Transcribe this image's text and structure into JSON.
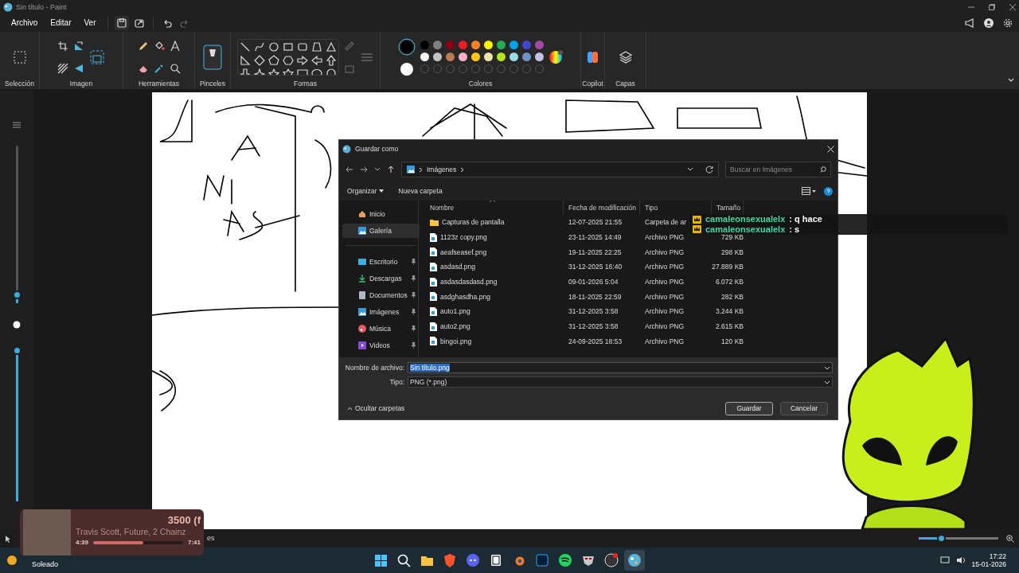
{
  "window": {
    "title": "Sin título - Paint"
  },
  "menu": [
    {
      "label": "Archivo"
    },
    {
      "label": "Editar"
    },
    {
      "label": "Ver"
    }
  ],
  "quick_actions": [
    {
      "kind": "save",
      "disabled": false
    },
    {
      "kind": "share",
      "disabled": false
    },
    {
      "kind": "undo",
      "disabled": false
    },
    {
      "kind": "redo",
      "disabled": true
    }
  ],
  "ribbon": {
    "groups": [
      {
        "kind": "selection",
        "label": "Selección"
      },
      {
        "kind": "image",
        "label": "Imagen"
      },
      {
        "kind": "tools",
        "label": "Herramientas"
      },
      {
        "kind": "brushes",
        "label": "Pinceles"
      },
      {
        "kind": "shapes",
        "label": "Formas"
      },
      {
        "kind": "colors",
        "label": "Colores"
      },
      {
        "kind": "copilot",
        "label": "Copilot"
      },
      {
        "kind": "layers",
        "label": "Capas"
      }
    ],
    "active_colors": [
      {
        "color": "#000000"
      },
      {
        "color": "#ffffff"
      }
    ],
    "palette": [
      {
        "color": "#000000"
      },
      {
        "color": "#7f7f7f"
      },
      {
        "color": "#880015"
      },
      {
        "color": "#ed1c24"
      },
      {
        "color": "#ff7f27"
      },
      {
        "color": "#fff200"
      },
      {
        "color": "#22b14c"
      },
      {
        "color": "#00a2e8"
      },
      {
        "color": "#3f48cc"
      },
      {
        "color": "#a349a4"
      },
      {
        "color": "#ffffff"
      },
      {
        "color": "#c3c3c3"
      },
      {
        "color": "#b97a57"
      },
      {
        "color": "#ffaec9"
      },
      {
        "color": "#ffc90e"
      },
      {
        "color": "#efe4b0"
      },
      {
        "color": "#b5e61d"
      },
      {
        "color": "#99d9ea"
      },
      {
        "color": "#7092be"
      },
      {
        "color": "#c8bfe7"
      }
    ]
  },
  "side_sliders": [
    {
      "level": 0.05
    },
    {
      "level": 0.97
    }
  ],
  "dialog": {
    "title": "Guardar como",
    "path": [
      {
        "label": "Imágenes"
      }
    ],
    "search": {
      "placeholder": "Buscar en Imágenes"
    },
    "toolbar": [
      {
        "label": "Organizar",
        "dropdown": true
      },
      {
        "label": "Nueva carpeta",
        "dropdown": false
      }
    ],
    "nav": [
      {
        "kind": "home",
        "label": "Inicio",
        "selected": false,
        "pinned": false
      },
      {
        "kind": "gallery",
        "label": "Galería",
        "selected": true,
        "pinned": false
      },
      {
        "kind": "desktop",
        "label": "Escritorio",
        "selected": false,
        "pinned": true
      },
      {
        "kind": "downloads",
        "label": "Descargas",
        "selected": false,
        "pinned": true
      },
      {
        "kind": "documents",
        "label": "Documentos",
        "selected": false,
        "pinned": true
      },
      {
        "kind": "pictures",
        "label": "Imágenes",
        "selected": false,
        "pinned": true
      },
      {
        "kind": "music",
        "label": "Música",
        "selected": false,
        "pinned": true
      },
      {
        "kind": "videos",
        "label": "Videos",
        "selected": false,
        "pinned": true
      }
    ],
    "columns": [
      {
        "label": "Nombre",
        "sorted": true
      },
      {
        "label": "Fecha de modificación",
        "sorted": false
      },
      {
        "label": "Tipo",
        "sorted": false
      },
      {
        "label": "Tamaño",
        "sorted": false
      }
    ],
    "rows": [
      {
        "kind": "folder",
        "name": "Capturas de pantalla",
        "date": "12-07-2025 21:55",
        "type": "Carpeta de ar",
        "size": ""
      },
      {
        "kind": "file",
        "name": "1123z copy.png",
        "date": "23-11-2025 14:49",
        "type": "Archivo PNG",
        "size": "729 KB"
      },
      {
        "kind": "file",
        "name": "aeafseasef.png",
        "date": "19-11-2025 22:25",
        "type": "Archivo PNG",
        "size": "298 KB"
      },
      {
        "kind": "file",
        "name": "asdasd.png",
        "date": "31-12-2025 16:40",
        "type": "Archivo PNG",
        "size": "27.889 KB"
      },
      {
        "kind": "file",
        "name": "asdasdasdasd.png",
        "date": "09-01-2026 5:04",
        "type": "Archivo PNG",
        "size": "6.072 KB"
      },
      {
        "kind": "file",
        "name": "asdghasdha.png",
        "date": "18-11-2025 22:59",
        "type": "Archivo PNG",
        "size": "282 KB"
      },
      {
        "kind": "file",
        "name": "auto1.png",
        "date": "31-12-2025 3:58",
        "type": "Archivo PNG",
        "size": "3.244 KB"
      },
      {
        "kind": "file",
        "name": "auto2.png",
        "date": "31-12-2025 3:58",
        "type": "Archivo PNG",
        "size": "2.615 KB"
      },
      {
        "kind": "file",
        "name": "bingoi.png",
        "date": "24-09-2025 18:53",
        "type": "Archivo PNG",
        "size": "120 KB"
      }
    ],
    "filename": {
      "label": "Nombre de archivo:",
      "value": "Sin título.png",
      "selected": true
    },
    "filetype": {
      "label": "Tipo:",
      "value": "PNG (*.png)"
    },
    "hide_folders": {
      "label": "Ocultar carpetas"
    },
    "buttons": [
      {
        "label": "Guardar",
        "default": true
      },
      {
        "label": "Cancelar",
        "default": false
      }
    ]
  },
  "chat": [
    {
      "user": "camaleonsexualelx",
      "text": ": q hace"
    },
    {
      "user": "camaleonsexualelx",
      "text": ": s"
    }
  ],
  "now_playing": {
    "title": "3500 (f",
    "artist": "Travis Scott, Future, 2 Chainz",
    "elapsed": "4:39",
    "total": "7:41",
    "level": 0.56
  },
  "status_bar": {
    "text": "es",
    "zoom": {
      "level": 0.28
    }
  },
  "taskbar": {
    "weather": {
      "text": "Soleado"
    },
    "apps": [
      {
        "kind": "start",
        "active": false
      },
      {
        "kind": "search",
        "active": false
      },
      {
        "kind": "files",
        "active": false
      },
      {
        "kind": "shield",
        "active": false
      },
      {
        "kind": "chat",
        "active": false
      },
      {
        "kind": "notes",
        "active": false
      },
      {
        "kind": "blender",
        "active": false
      },
      {
        "kind": "square",
        "active": false
      },
      {
        "kind": "music",
        "active": false
      },
      {
        "kind": "mask",
        "active": false
      },
      {
        "kind": "record",
        "active": false
      },
      {
        "kind": "paint",
        "active": true
      }
    ],
    "time": "17:22",
    "date": "15-01-2026"
  }
}
